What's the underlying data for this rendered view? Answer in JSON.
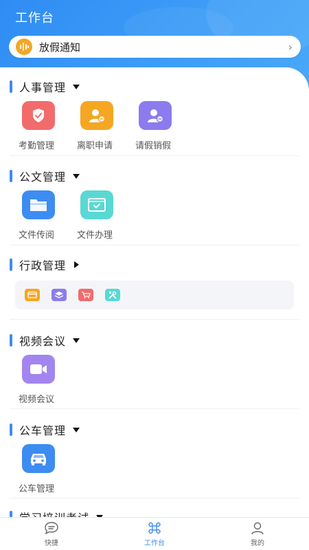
{
  "header": {
    "title": "工作台",
    "background_color": "#3e9ff7"
  },
  "notice": {
    "icon": "voice-wave-icon",
    "text": "放假通知",
    "arrow": "›"
  },
  "sections": [
    {
      "title": "人事管理",
      "expanded": true,
      "items": [
        {
          "label": "考勤管理",
          "icon": "shield-check-icon",
          "color": "#f26b6b"
        },
        {
          "label": "离职申请",
          "icon": "user-exit-icon",
          "color": "#f5a623"
        },
        {
          "label": "请假销假",
          "icon": "user-leave-icon",
          "color": "#8c7bee"
        }
      ]
    },
    {
      "title": "公文管理",
      "expanded": true,
      "items": [
        {
          "label": "文件传阅",
          "icon": "folder-icon",
          "color": "#3d8cf2"
        },
        {
          "label": "文件办理",
          "icon": "document-check-icon",
          "color": "#5ad8d4"
        }
      ]
    },
    {
      "title": "行政管理",
      "expanded": false,
      "mini_icons": [
        {
          "icon": "card-icon",
          "color": "#f5a623"
        },
        {
          "icon": "layers-icon",
          "color": "#8c7bee"
        },
        {
          "icon": "cart-icon",
          "color": "#f26b6b"
        },
        {
          "icon": "tools-icon",
          "color": "#5ad8d4"
        }
      ]
    },
    {
      "title": "视频会议",
      "expanded": true,
      "items": [
        {
          "label": "视频会议",
          "icon": "video-camera-icon",
          "color": "#a385f0"
        }
      ]
    },
    {
      "title": "公车管理",
      "expanded": true,
      "items": [
        {
          "label": "公车管理",
          "icon": "car-icon",
          "color": "#3d8cf2"
        }
      ]
    },
    {
      "title": "学习培训考试",
      "expanded": true
    }
  ],
  "tabbar": {
    "tabs": [
      {
        "label": "快捷",
        "icon": "chat-bubble-icon",
        "active": false
      },
      {
        "label": "工作台",
        "icon": "command-icon",
        "active": true
      },
      {
        "label": "我的",
        "icon": "user-icon",
        "active": false
      }
    ],
    "accent_color": "#3d8cf2"
  }
}
